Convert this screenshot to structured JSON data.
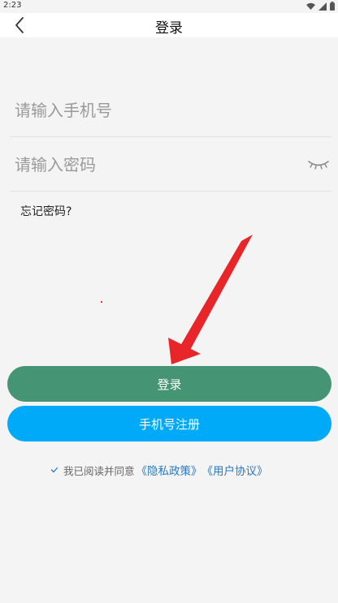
{
  "status_bar": {
    "time": "2:23",
    "icons": [
      "wifi-icon",
      "signal-icon",
      "battery-icon"
    ]
  },
  "nav": {
    "title": "登录",
    "back_icon": "chevron-left-icon"
  },
  "form": {
    "phone_placeholder": "请输入手机号",
    "phone_value": "",
    "password_placeholder": "请输入密码",
    "password_value": "",
    "password_visibility_icon": "eye-closed-icon",
    "forgot_label": "忘记密码?"
  },
  "actions": {
    "login_label": "登录",
    "register_label": "手机号注册"
  },
  "agreement": {
    "checked": true,
    "text": "我已阅读并同意",
    "privacy_link": "《隐私政策》",
    "terms_link": "《用户协议》"
  },
  "colors": {
    "background": "#f4f4f4",
    "login_button": "#459474",
    "register_button": "#00aaf8",
    "link": "#2a78c2",
    "annotation_arrow": "#e8262a"
  }
}
